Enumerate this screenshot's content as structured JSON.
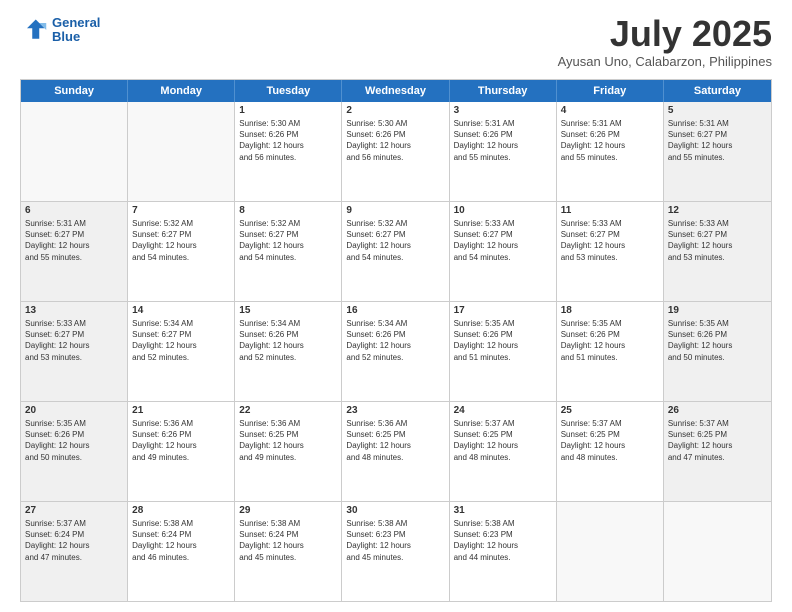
{
  "header": {
    "logo_line1": "General",
    "logo_line2": "Blue",
    "month_title": "July 2025",
    "location": "Ayusan Uno, Calabarzon, Philippines"
  },
  "weekdays": [
    "Sunday",
    "Monday",
    "Tuesday",
    "Wednesday",
    "Thursday",
    "Friday",
    "Saturday"
  ],
  "rows": [
    [
      {
        "day": "",
        "lines": [],
        "empty": true
      },
      {
        "day": "",
        "lines": [],
        "empty": true
      },
      {
        "day": "1",
        "lines": [
          "Sunrise: 5:30 AM",
          "Sunset: 6:26 PM",
          "Daylight: 12 hours",
          "and 56 minutes."
        ],
        "empty": false
      },
      {
        "day": "2",
        "lines": [
          "Sunrise: 5:30 AM",
          "Sunset: 6:26 PM",
          "Daylight: 12 hours",
          "and 56 minutes."
        ],
        "empty": false
      },
      {
        "day": "3",
        "lines": [
          "Sunrise: 5:31 AM",
          "Sunset: 6:26 PM",
          "Daylight: 12 hours",
          "and 55 minutes."
        ],
        "empty": false
      },
      {
        "day": "4",
        "lines": [
          "Sunrise: 5:31 AM",
          "Sunset: 6:26 PM",
          "Daylight: 12 hours",
          "and 55 minutes."
        ],
        "empty": false
      },
      {
        "day": "5",
        "lines": [
          "Sunrise: 5:31 AM",
          "Sunset: 6:27 PM",
          "Daylight: 12 hours",
          "and 55 minutes."
        ],
        "empty": false
      }
    ],
    [
      {
        "day": "6",
        "lines": [
          "Sunrise: 5:31 AM",
          "Sunset: 6:27 PM",
          "Daylight: 12 hours",
          "and 55 minutes."
        ],
        "empty": false
      },
      {
        "day": "7",
        "lines": [
          "Sunrise: 5:32 AM",
          "Sunset: 6:27 PM",
          "Daylight: 12 hours",
          "and 54 minutes."
        ],
        "empty": false
      },
      {
        "day": "8",
        "lines": [
          "Sunrise: 5:32 AM",
          "Sunset: 6:27 PM",
          "Daylight: 12 hours",
          "and 54 minutes."
        ],
        "empty": false
      },
      {
        "day": "9",
        "lines": [
          "Sunrise: 5:32 AM",
          "Sunset: 6:27 PM",
          "Daylight: 12 hours",
          "and 54 minutes."
        ],
        "empty": false
      },
      {
        "day": "10",
        "lines": [
          "Sunrise: 5:33 AM",
          "Sunset: 6:27 PM",
          "Daylight: 12 hours",
          "and 54 minutes."
        ],
        "empty": false
      },
      {
        "day": "11",
        "lines": [
          "Sunrise: 5:33 AM",
          "Sunset: 6:27 PM",
          "Daylight: 12 hours",
          "and 53 minutes."
        ],
        "empty": false
      },
      {
        "day": "12",
        "lines": [
          "Sunrise: 5:33 AM",
          "Sunset: 6:27 PM",
          "Daylight: 12 hours",
          "and 53 minutes."
        ],
        "empty": false
      }
    ],
    [
      {
        "day": "13",
        "lines": [
          "Sunrise: 5:33 AM",
          "Sunset: 6:27 PM",
          "Daylight: 12 hours",
          "and 53 minutes."
        ],
        "empty": false
      },
      {
        "day": "14",
        "lines": [
          "Sunrise: 5:34 AM",
          "Sunset: 6:27 PM",
          "Daylight: 12 hours",
          "and 52 minutes."
        ],
        "empty": false
      },
      {
        "day": "15",
        "lines": [
          "Sunrise: 5:34 AM",
          "Sunset: 6:26 PM",
          "Daylight: 12 hours",
          "and 52 minutes."
        ],
        "empty": false
      },
      {
        "day": "16",
        "lines": [
          "Sunrise: 5:34 AM",
          "Sunset: 6:26 PM",
          "Daylight: 12 hours",
          "and 52 minutes."
        ],
        "empty": false
      },
      {
        "day": "17",
        "lines": [
          "Sunrise: 5:35 AM",
          "Sunset: 6:26 PM",
          "Daylight: 12 hours",
          "and 51 minutes."
        ],
        "empty": false
      },
      {
        "day": "18",
        "lines": [
          "Sunrise: 5:35 AM",
          "Sunset: 6:26 PM",
          "Daylight: 12 hours",
          "and 51 minutes."
        ],
        "empty": false
      },
      {
        "day": "19",
        "lines": [
          "Sunrise: 5:35 AM",
          "Sunset: 6:26 PM",
          "Daylight: 12 hours",
          "and 50 minutes."
        ],
        "empty": false
      }
    ],
    [
      {
        "day": "20",
        "lines": [
          "Sunrise: 5:35 AM",
          "Sunset: 6:26 PM",
          "Daylight: 12 hours",
          "and 50 minutes."
        ],
        "empty": false
      },
      {
        "day": "21",
        "lines": [
          "Sunrise: 5:36 AM",
          "Sunset: 6:26 PM",
          "Daylight: 12 hours",
          "and 49 minutes."
        ],
        "empty": false
      },
      {
        "day": "22",
        "lines": [
          "Sunrise: 5:36 AM",
          "Sunset: 6:25 PM",
          "Daylight: 12 hours",
          "and 49 minutes."
        ],
        "empty": false
      },
      {
        "day": "23",
        "lines": [
          "Sunrise: 5:36 AM",
          "Sunset: 6:25 PM",
          "Daylight: 12 hours",
          "and 48 minutes."
        ],
        "empty": false
      },
      {
        "day": "24",
        "lines": [
          "Sunrise: 5:37 AM",
          "Sunset: 6:25 PM",
          "Daylight: 12 hours",
          "and 48 minutes."
        ],
        "empty": false
      },
      {
        "day": "25",
        "lines": [
          "Sunrise: 5:37 AM",
          "Sunset: 6:25 PM",
          "Daylight: 12 hours",
          "and 48 minutes."
        ],
        "empty": false
      },
      {
        "day": "26",
        "lines": [
          "Sunrise: 5:37 AM",
          "Sunset: 6:25 PM",
          "Daylight: 12 hours",
          "and 47 minutes."
        ],
        "empty": false
      }
    ],
    [
      {
        "day": "27",
        "lines": [
          "Sunrise: 5:37 AM",
          "Sunset: 6:24 PM",
          "Daylight: 12 hours",
          "and 47 minutes."
        ],
        "empty": false
      },
      {
        "day": "28",
        "lines": [
          "Sunrise: 5:38 AM",
          "Sunset: 6:24 PM",
          "Daylight: 12 hours",
          "and 46 minutes."
        ],
        "empty": false
      },
      {
        "day": "29",
        "lines": [
          "Sunrise: 5:38 AM",
          "Sunset: 6:24 PM",
          "Daylight: 12 hours",
          "and 45 minutes."
        ],
        "empty": false
      },
      {
        "day": "30",
        "lines": [
          "Sunrise: 5:38 AM",
          "Sunset: 6:23 PM",
          "Daylight: 12 hours",
          "and 45 minutes."
        ],
        "empty": false
      },
      {
        "day": "31",
        "lines": [
          "Sunrise: 5:38 AM",
          "Sunset: 6:23 PM",
          "Daylight: 12 hours",
          "and 44 minutes."
        ],
        "empty": false
      },
      {
        "day": "",
        "lines": [],
        "empty": true
      },
      {
        "day": "",
        "lines": [],
        "empty": true
      }
    ]
  ]
}
